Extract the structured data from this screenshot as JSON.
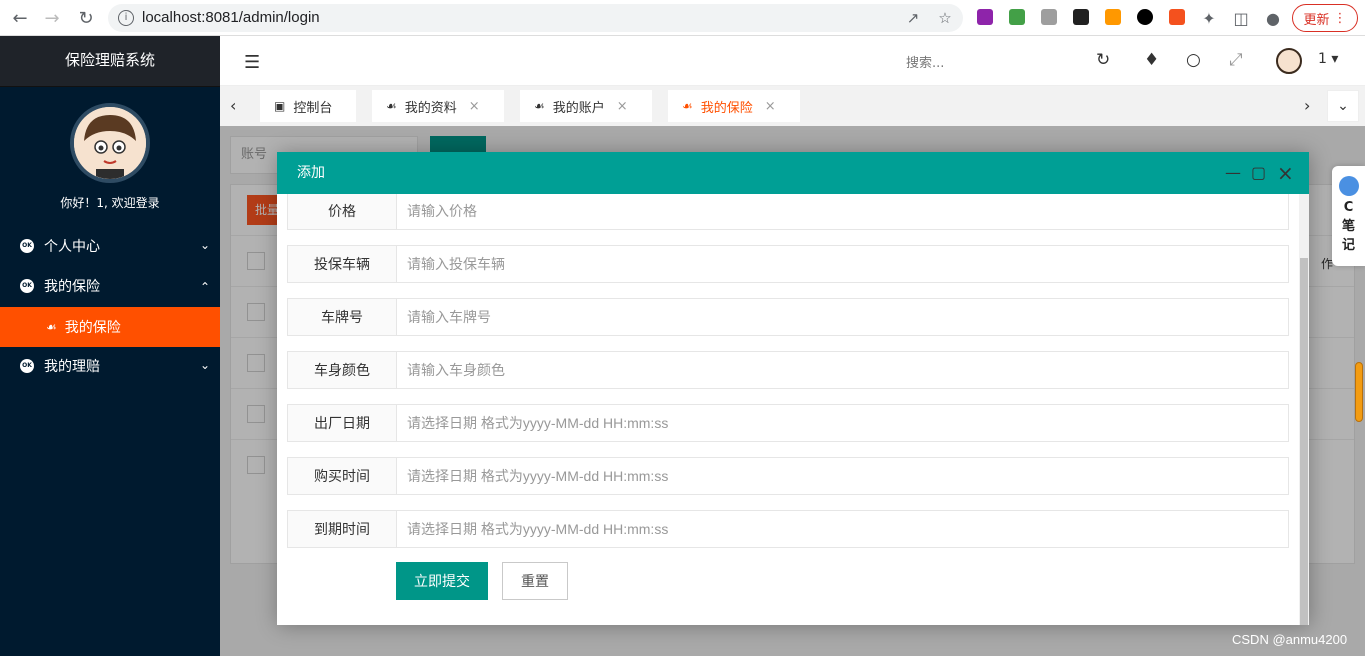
{
  "browser": {
    "url": "localhost:8081/admin/login",
    "update_label": "更新"
  },
  "sidebar": {
    "title": "保险理赔系统",
    "welcome": "你好！1, 欢迎登录",
    "badge": "OK",
    "items": [
      {
        "label": "个人中心",
        "chevron": "⌄"
      },
      {
        "label": "我的保险",
        "chevron": "⌃"
      },
      {
        "label": "我的保险"
      },
      {
        "label": "我的理赔",
        "chevron": "⌄"
      }
    ]
  },
  "header": {
    "search_placeholder": "搜索...",
    "user": "1"
  },
  "tabs": [
    {
      "label": "控制台"
    },
    {
      "label": "我的资料"
    },
    {
      "label": "我的账户"
    },
    {
      "label": "我的保险"
    }
  ],
  "background": {
    "account_placeholder": "账号",
    "batch_label": "批量",
    "col_fragment": "作"
  },
  "modal": {
    "title": "添加",
    "fields": [
      {
        "label": "价格",
        "placeholder": "请输入价格"
      },
      {
        "label": "投保车辆",
        "placeholder": "请输入投保车辆"
      },
      {
        "label": "车牌号",
        "placeholder": "请输入车牌号"
      },
      {
        "label": "车身颜色",
        "placeholder": "请输入车身颜色"
      },
      {
        "label": "出厂日期",
        "placeholder": "请选择日期 格式为yyyy-MM-dd HH:mm:ss"
      },
      {
        "label": "购买时间",
        "placeholder": "请选择日期 格式为yyyy-MM-dd HH:mm:ss"
      },
      {
        "label": "到期时间",
        "placeholder": "请选择日期 格式为yyyy-MM-dd HH:mm:ss"
      }
    ],
    "submit_label": "立即提交",
    "reset_label": "重置"
  },
  "note_widget": {
    "line1": "C",
    "line2": "笔",
    "line3": "记"
  },
  "watermark": "CSDN @anmu4200",
  "colors": {
    "sidebar_bg": "#001a2f",
    "active_menu": "#ff5000",
    "modal_header": "#009f95",
    "primary_button": "#009688"
  }
}
